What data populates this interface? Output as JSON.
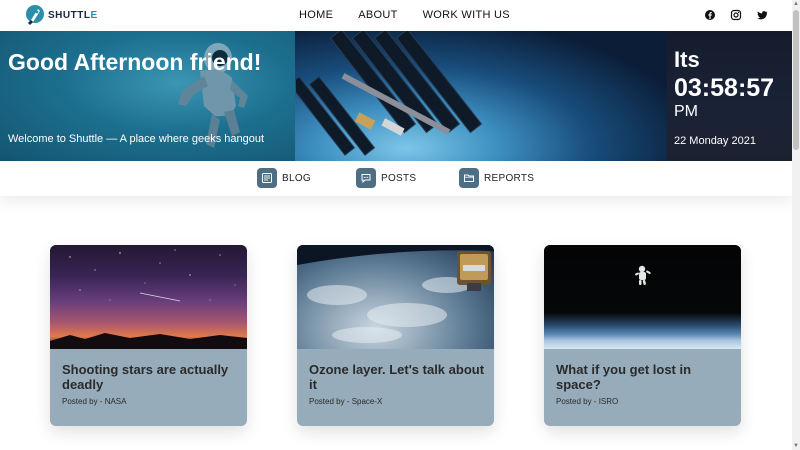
{
  "brand": {
    "name_main": "SHUTTL",
    "name_accent": "E"
  },
  "nav": {
    "links": [
      "HOME",
      "ABOUT",
      "WORK WITH US"
    ]
  },
  "socials": [
    "facebook-icon",
    "instagram-icon",
    "twitter-icon"
  ],
  "hero": {
    "greeting": "Good Afternoon friend!",
    "welcome": "Welcome to Shuttle — A place where geeks hangout",
    "its": "Its",
    "time": "03:58:57",
    "ampm": "PM",
    "date": "22 Monday 2021"
  },
  "tabs": [
    {
      "label": "BLOG",
      "icon": "blog-icon"
    },
    {
      "label": "POSTS",
      "icon": "posts-icon"
    },
    {
      "label": "REPORTS",
      "icon": "reports-icon"
    }
  ],
  "cards": [
    {
      "title": "Shooting stars are actually deadly",
      "meta": "Posted by - NASA",
      "image": "night-sky-image"
    },
    {
      "title": "Ozone layer. Let's talk about it",
      "meta": "Posted by - Space-X",
      "image": "earth-orbit-image"
    },
    {
      "title": "What if you get lost in space?",
      "meta": "Posted by - ISRO",
      "image": "astronaut-space-image"
    }
  ],
  "colors": {
    "accent": "#2c8fa8",
    "card_bg": "#97acbb",
    "tab_icon_bg": "#4e6e84"
  }
}
